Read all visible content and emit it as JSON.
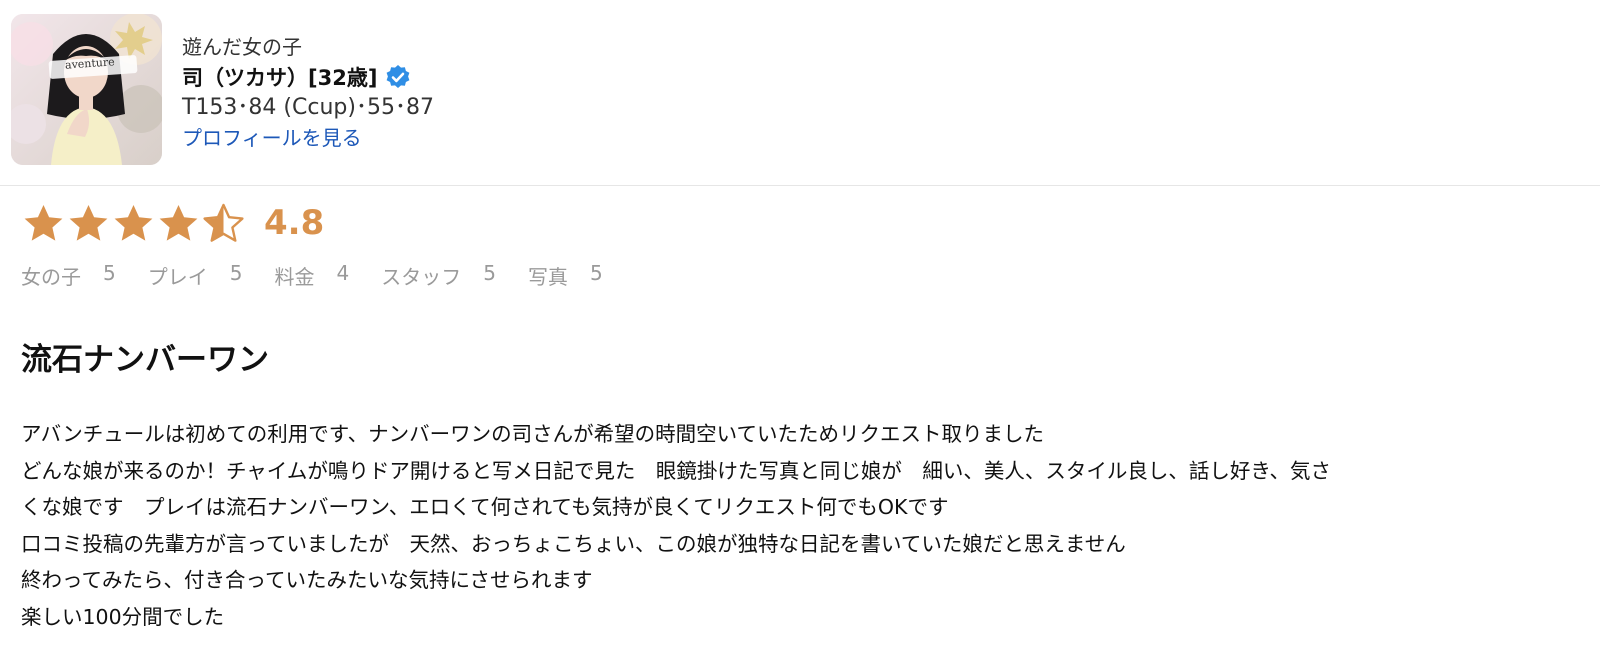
{
  "profile": {
    "label": "遊んだ女の子",
    "name": "司（ツカサ）[32歳]",
    "sizes": "T153･84 (Ccup)･55･87",
    "profile_link": "プロフィールを見る",
    "photo_caption": "aventure",
    "verified_icon": "verified-check-icon"
  },
  "rating": {
    "score": "4.8",
    "stars": 4.5,
    "star_color": "#d9924d"
  },
  "subscores": [
    {
      "label": "女の子",
      "value": "5"
    },
    {
      "label": "プレイ",
      "value": "5"
    },
    {
      "label": "料金",
      "value": "4"
    },
    {
      "label": "スタッフ",
      "value": "5"
    },
    {
      "label": "写真",
      "value": "5"
    }
  ],
  "review": {
    "title": "流石ナンバーワン",
    "lines": [
      "アバンチュールは初めての利用です、ナンバーワンの司さんが希望の時間空いていたためリクエスト取りました",
      "どんな娘が来るのか！チャイムが鳴りドア開けると写メ日記で見た　眼鏡掛けた写真と同じ娘が　細い、美人、スタイル良し、話し好き、気さ",
      "くな娘です　プレイは流石ナンバーワン、エロくて何されても気持が良くてリクエスト何でもOKです",
      "口コミ投稿の先輩方が言っていましたが　天然、おっちょこちょい、この娘が独特な日記を書いていた娘だと思えません",
      "終わってみたら、付き合っていたみたいな気持にさせられます",
      "楽しい100分間でした"
    ]
  }
}
